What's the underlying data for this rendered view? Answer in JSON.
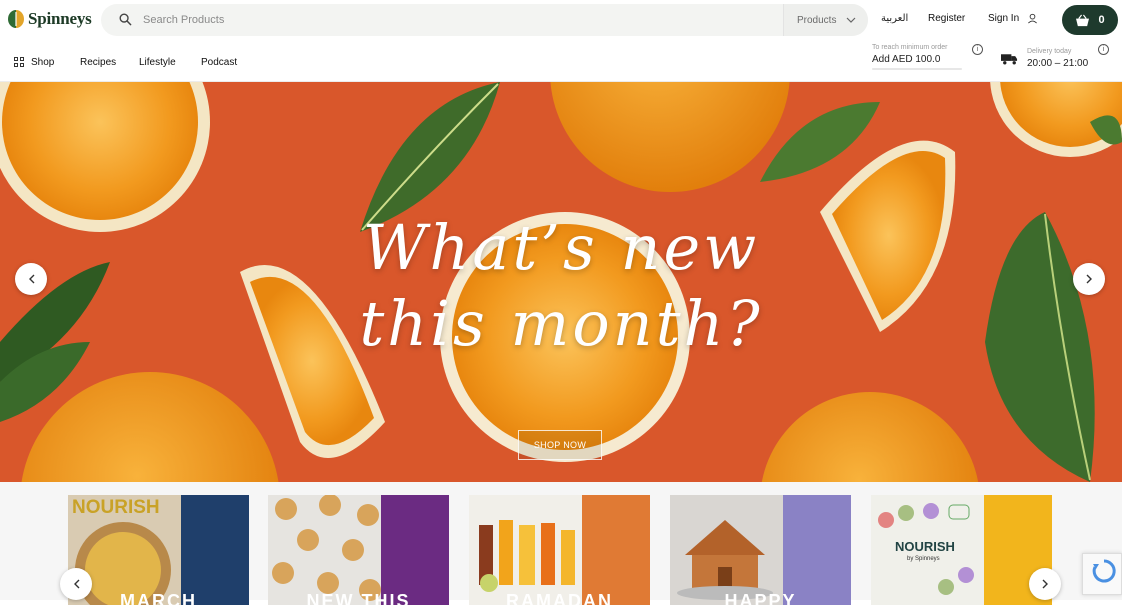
{
  "header": {
    "brand": "Spinneys",
    "search_placeholder": "Search Products",
    "category_select": "Products",
    "language": "العربية",
    "register": "Register",
    "sign_in": "Sign In",
    "cart_count": "0"
  },
  "nav": {
    "items": [
      {
        "label": "Shop"
      },
      {
        "label": "Recipes"
      },
      {
        "label": "Lifestyle"
      },
      {
        "label": "Podcast"
      }
    ],
    "min_order_note": "To reach minimum order",
    "min_order_amount": "Add AED 100.0",
    "delivery_note": "Delivery today",
    "delivery_window": "20:00 – 21:00"
  },
  "hero": {
    "title_line1": "What’s new",
    "title_line2": "this month?",
    "cta": "SHOP NOW"
  },
  "cards": {
    "items": [
      {
        "badge": "NOURISH",
        "caption": "MARCH",
        "band_color": "#1f3f6b"
      },
      {
        "badge": "",
        "caption": "NEW THIS",
        "band_color": "#6b2b82"
      },
      {
        "badge": "",
        "caption": "RAMADAN",
        "band_color": "#e07a34"
      },
      {
        "badge": "",
        "caption": "HAPPY",
        "band_color": "#8a82c5"
      },
      {
        "badge": "NOURISH",
        "badge_sub": "by Spinneys",
        "caption": "",
        "band_color": "#f2b51c"
      }
    ]
  },
  "colors": {
    "brand_dark": "#1e3a2d",
    "hero_bg": "#d8552a"
  }
}
